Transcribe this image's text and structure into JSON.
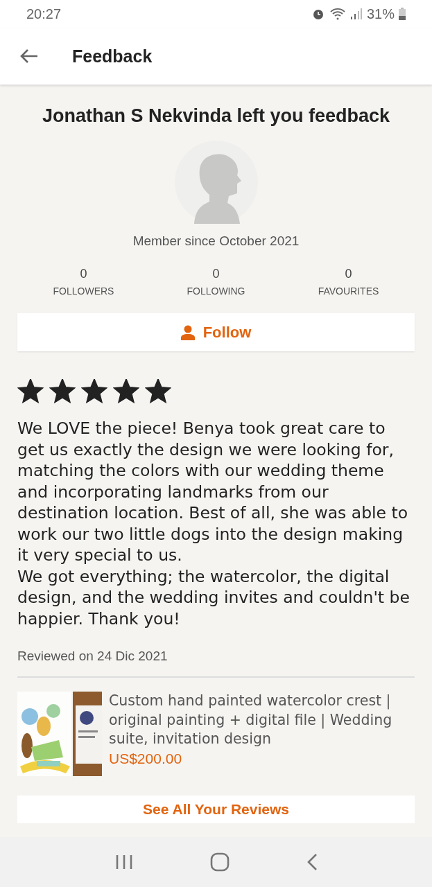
{
  "status_bar": {
    "time": "20:27",
    "battery": "31%"
  },
  "header": {
    "title": "Feedback"
  },
  "feedback": {
    "heading": "Jonathan S Nekvinda left you feedback",
    "member_since": "Member since October 2021",
    "stats": [
      {
        "value": "0",
        "label": "FOLLOWERS"
      },
      {
        "value": "0",
        "label": "FOLLOWING"
      },
      {
        "value": "0",
        "label": "FAVOURITES"
      }
    ],
    "follow_button": "Follow",
    "stars": 5,
    "review": [
      "We LOVE the piece! Benya took great care to get us exactly the design we were looking for, matching the colors with our wedding theme and incorporating landmarks from our destination location. Best of all, she was able to work our two little dogs into the design making it very special to us.",
      "We got everything; the watercolor, the digital design, and the wedding invites and couldn't be happier. Thank you!"
    ],
    "reviewed_on": "Reviewed on 24 Dic 2021",
    "item": {
      "title": "Custom hand painted watercolor crest | original painting + digital file | Wedding suite, invitation design",
      "price": "US$200.00"
    },
    "all_reviews_button": "See All Your Reviews"
  }
}
